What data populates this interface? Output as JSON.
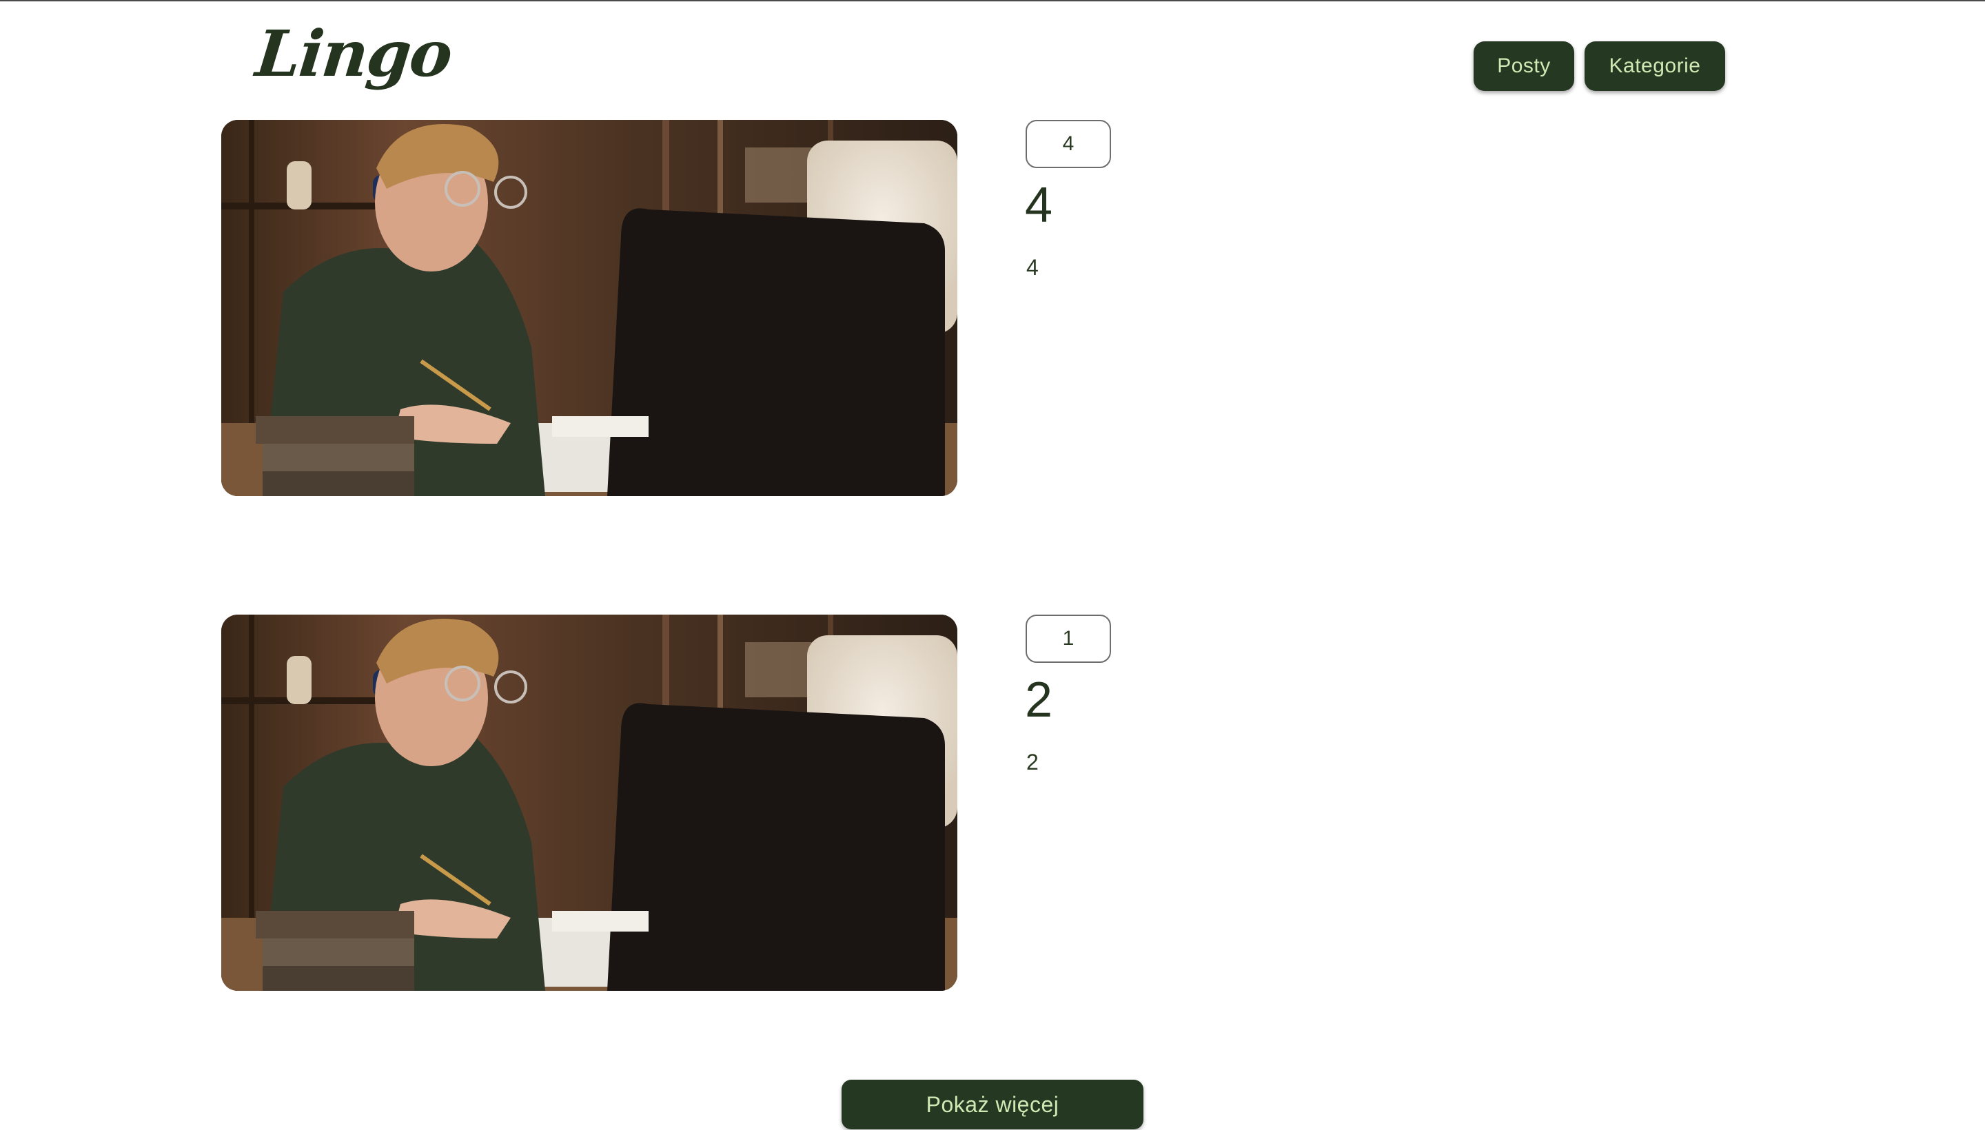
{
  "header": {
    "logo_text": "Lingo",
    "nav": {
      "posts_label": "Posty",
      "categories_label": "Kategorie"
    }
  },
  "posts": [
    {
      "category": "4",
      "title": "4",
      "excerpt": "4",
      "image_icon": "photo-man-studying-at-laptop"
    },
    {
      "category": "1",
      "title": "2",
      "excerpt": "2",
      "image_icon": "photo-man-studying-at-laptop"
    }
  ],
  "footer": {
    "more_label": "Pokaż więcej"
  },
  "colors": {
    "brand_dark_green": "#243822",
    "button_text": "#cfe9b4",
    "text": "#2a3a22"
  }
}
